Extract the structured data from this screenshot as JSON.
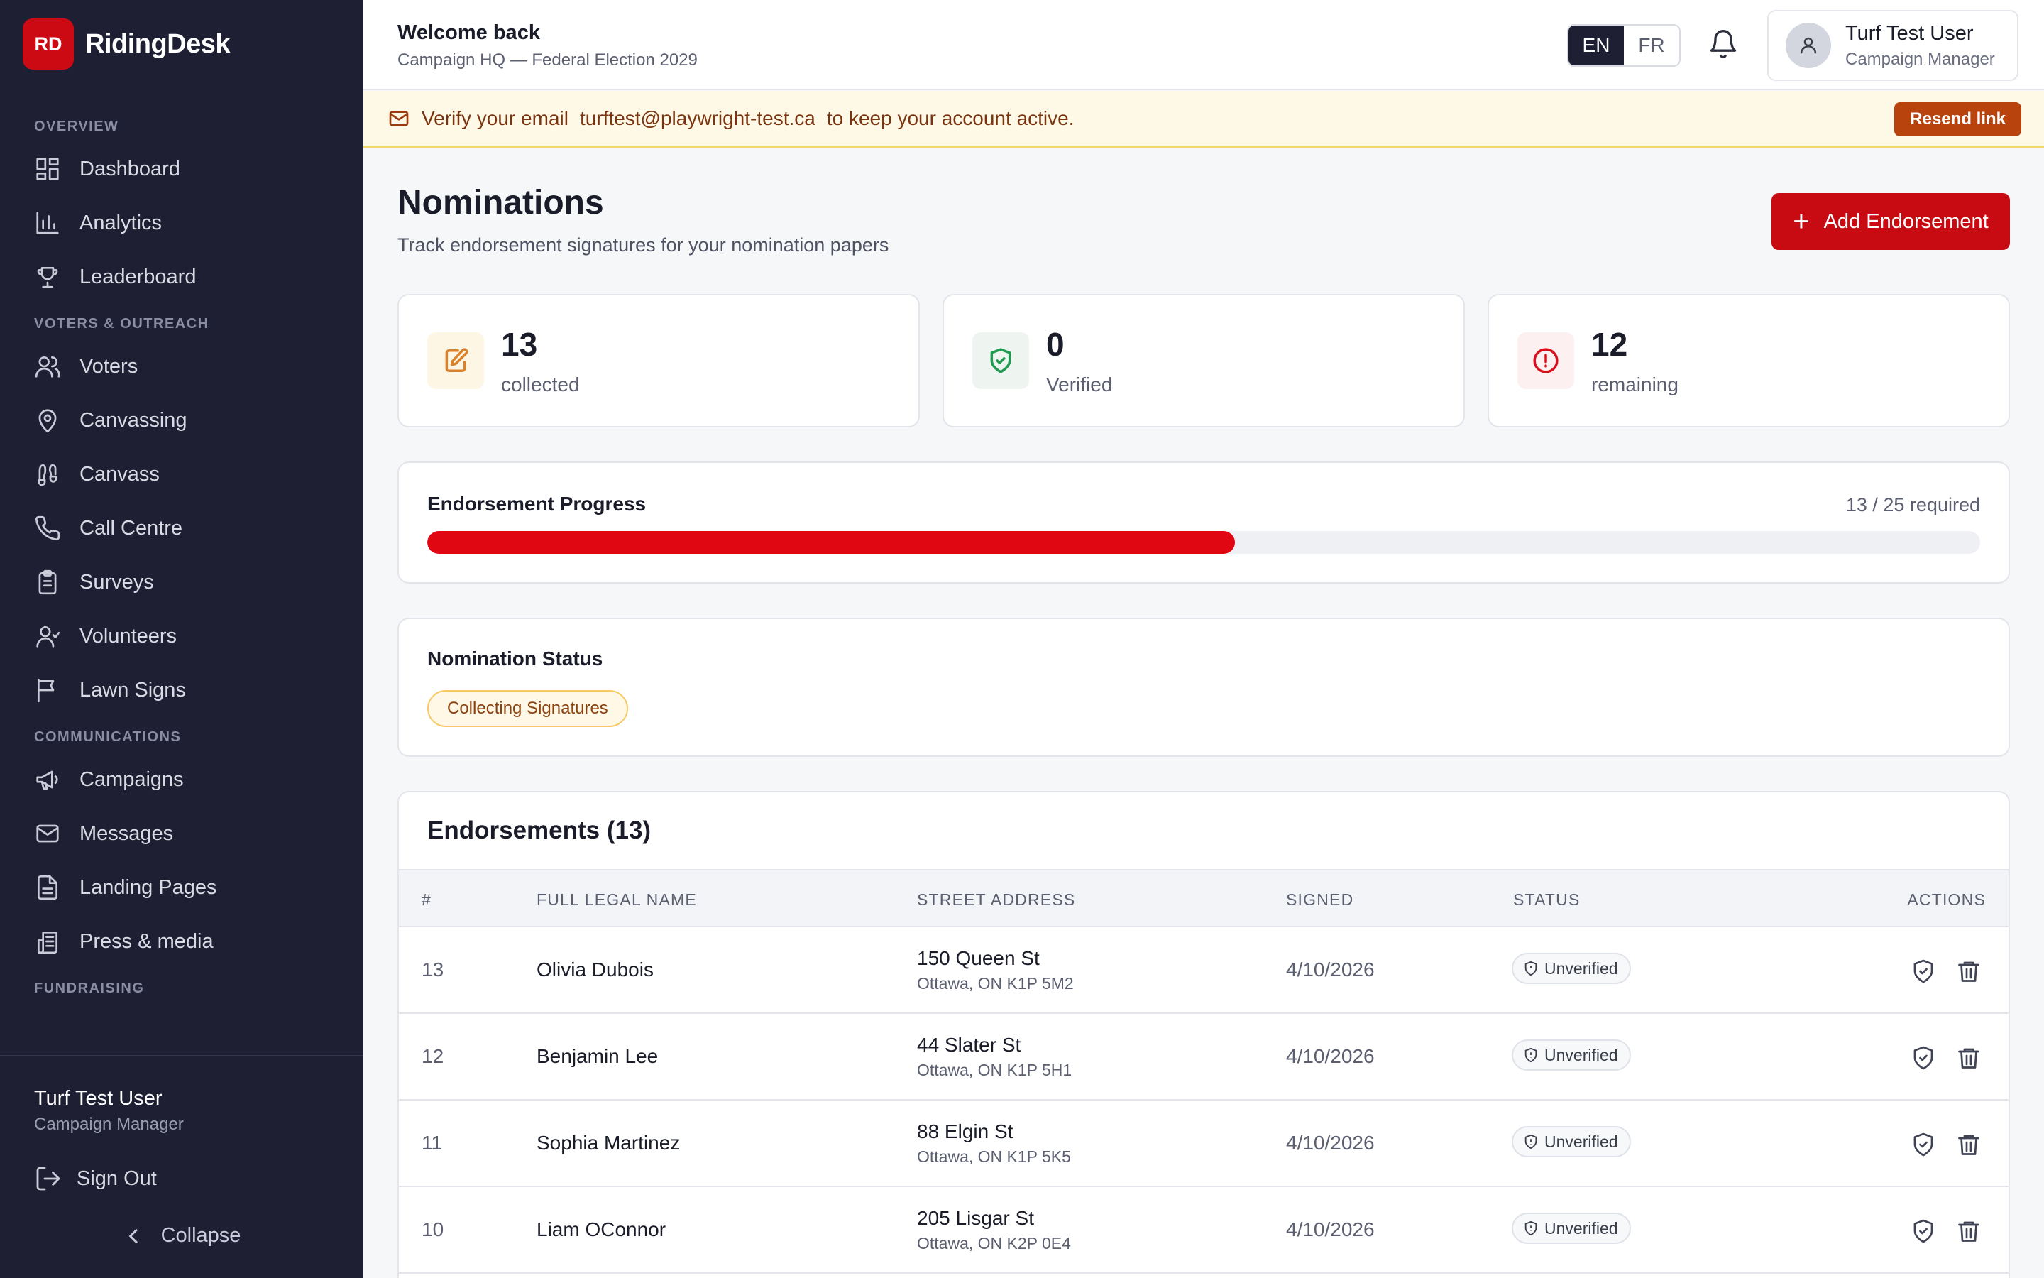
{
  "brand": {
    "badge": "RD",
    "name": "RidingDesk"
  },
  "sidebar": {
    "sections": [
      {
        "title": "OVERVIEW",
        "items": [
          {
            "label": "Dashboard",
            "icon": "dashboard-icon"
          },
          {
            "label": "Analytics",
            "icon": "bar-chart-icon"
          },
          {
            "label": "Leaderboard",
            "icon": "trophy-icon"
          }
        ]
      },
      {
        "title": "VOTERS & OUTREACH",
        "items": [
          {
            "label": "Voters",
            "icon": "users-icon"
          },
          {
            "label": "Canvassing",
            "icon": "map-pin-icon"
          },
          {
            "label": "Canvass",
            "icon": "footprints-icon"
          },
          {
            "label": "Call Centre",
            "icon": "phone-icon"
          },
          {
            "label": "Surveys",
            "icon": "clipboard-icon"
          },
          {
            "label": "Volunteers",
            "icon": "volunteers-icon"
          },
          {
            "label": "Lawn Signs",
            "icon": "flag-icon"
          }
        ]
      },
      {
        "title": "COMMUNICATIONS",
        "items": [
          {
            "label": "Campaigns",
            "icon": "megaphone-icon"
          },
          {
            "label": "Messages",
            "icon": "mail-icon"
          },
          {
            "label": "Landing Pages",
            "icon": "file-icon"
          },
          {
            "label": "Press & media",
            "icon": "newspaper-icon"
          }
        ]
      },
      {
        "title": "FUNDRAISING",
        "items": []
      }
    ],
    "user": {
      "name": "Turf Test User",
      "role": "Campaign Manager"
    },
    "sign_out": "Sign Out",
    "collapse": "Collapse"
  },
  "topbar": {
    "welcome": "Welcome back",
    "context": "Campaign HQ — Federal Election 2029",
    "lang_en": "EN",
    "lang_fr": "FR",
    "lang_active": "EN",
    "user_name": "Turf Test User",
    "user_role": "Campaign Manager"
  },
  "banner": {
    "prefix": "Verify your email",
    "email": "turftest@playwright-test.ca",
    "suffix": "to keep your account active.",
    "button": "Resend link"
  },
  "page": {
    "title": "Nominations",
    "subtitle": "Track endorsement signatures for your nomination papers",
    "add_button": "Add Endorsement"
  },
  "stats": [
    {
      "value": "13",
      "label": "collected",
      "icon": "edit-document-icon",
      "color": "#d9822b",
      "bg": "#fef6e4"
    },
    {
      "value": "0",
      "label": "Verified",
      "icon": "shield-check-icon",
      "color": "#1f9a50",
      "bg": "#eef5f0"
    },
    {
      "value": "12",
      "label": "remaining",
      "icon": "alert-circle-icon",
      "color": "#d8101b",
      "bg": "#fdf0f0"
    }
  ],
  "progress": {
    "title": "Endorsement Progress",
    "collected": 13,
    "required": 25,
    "label": "13 / 25 required",
    "color": "#e00612"
  },
  "nomination_status": {
    "title": "Nomination Status",
    "status": "Collecting Signatures"
  },
  "endorsements": {
    "title": "Endorsements (13)",
    "columns": [
      "#",
      "FULL LEGAL NAME",
      "STREET ADDRESS",
      "SIGNED",
      "STATUS",
      "ACTIONS"
    ],
    "rows": [
      {
        "num": "13",
        "name": "Olivia Dubois",
        "street": "150 Queen St",
        "city": "Ottawa, ON K1P 5M2",
        "signed": "4/10/2026",
        "status": "Unverified"
      },
      {
        "num": "12",
        "name": "Benjamin Lee",
        "street": "44 Slater St",
        "city": "Ottawa, ON K1P 5H1",
        "signed": "4/10/2026",
        "status": "Unverified"
      },
      {
        "num": "11",
        "name": "Sophia Martinez",
        "street": "88 Elgin St",
        "city": "Ottawa, ON K1P 5K5",
        "signed": "4/10/2026",
        "status": "Unverified"
      },
      {
        "num": "10",
        "name": "Liam OConnor",
        "street": "205 Lisgar St",
        "city": "Ottawa, ON K2P 0E4",
        "signed": "4/10/2026",
        "status": "Unverified"
      }
    ]
  }
}
